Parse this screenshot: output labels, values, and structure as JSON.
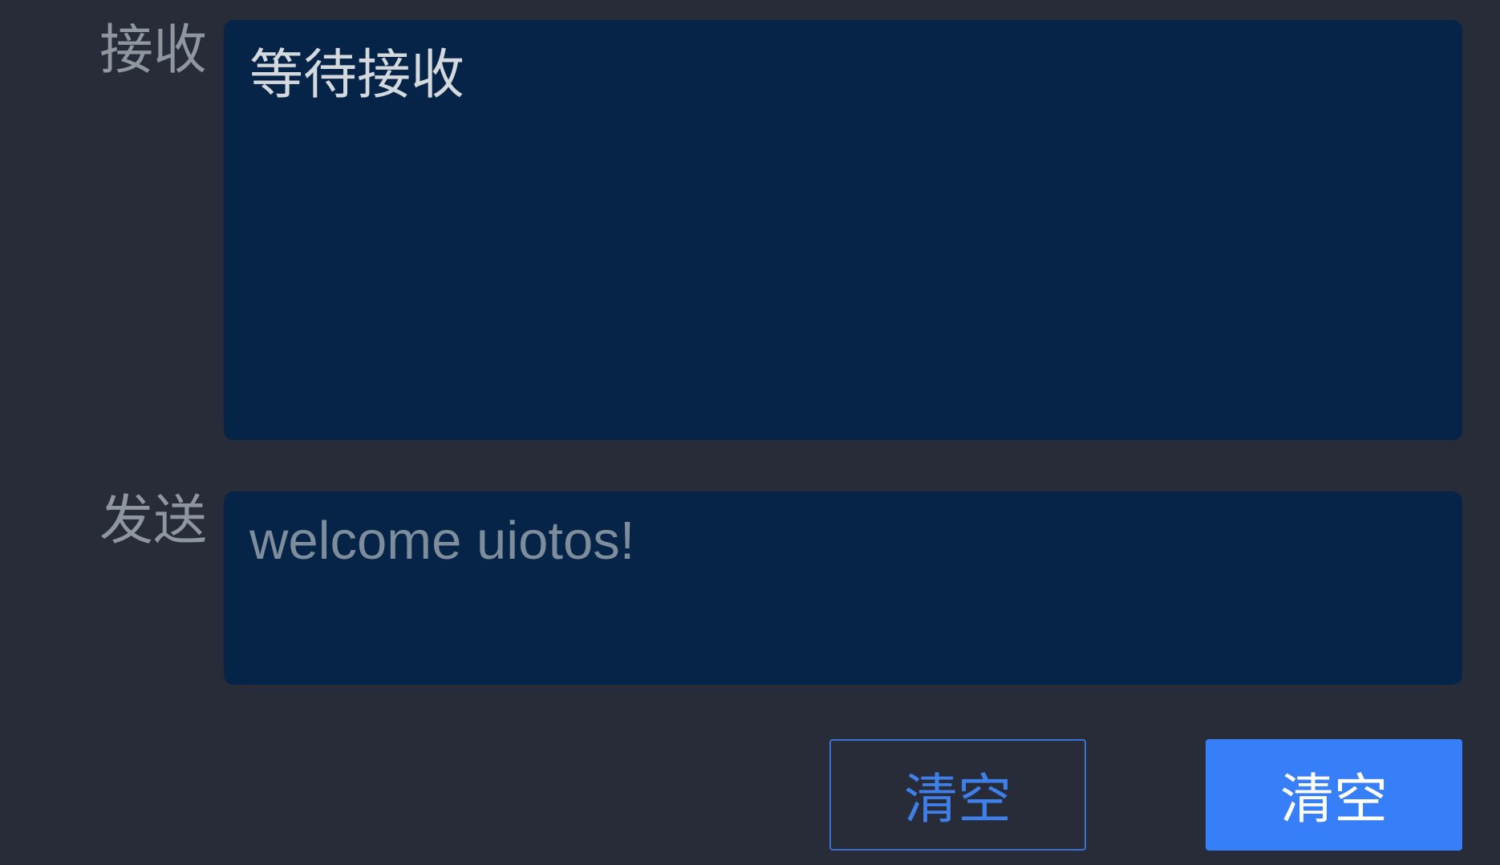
{
  "receive": {
    "label": "接收",
    "content": "等待接收"
  },
  "send": {
    "label": "发送",
    "value": "welcome uiotos!"
  },
  "buttons": {
    "clear_outline_label": "清空",
    "clear_primary_label": "清空"
  },
  "colors": {
    "background": "#272c38",
    "textbox_bg": "#062447",
    "label": "#8f969e",
    "accent": "#377ef9",
    "outline_border": "#3d6fd1"
  }
}
